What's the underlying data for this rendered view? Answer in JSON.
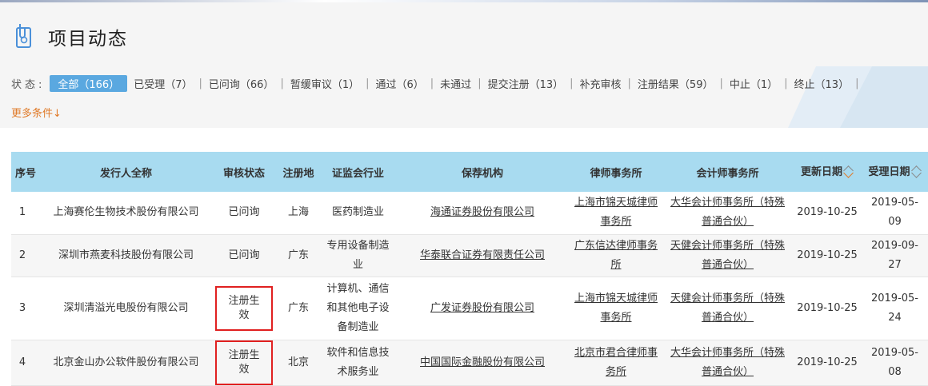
{
  "header": {
    "title": "项目动态"
  },
  "filter": {
    "status_label": "状态:",
    "items": [
      "全部（166）",
      "已受理（7）",
      "已问询（66）",
      "暂缓审议（1）",
      "通过（6）",
      "未通过",
      "提交注册（13）",
      "补充审核",
      "注册结果（59）",
      "中止（1）",
      "终止（13）"
    ],
    "active_index": 0,
    "more_label": "更多条件↓"
  },
  "table": {
    "headers": [
      "序号",
      "发行人全称",
      "审核状态",
      "注册地",
      "证监会行业",
      "保荐机构",
      "律师事务所",
      "会计师事务所",
      "更新日期",
      "受理日期"
    ],
    "rows": [
      {
        "idx": "1",
        "issuer": "上海赛伦生物技术股份有限公司",
        "status": "已问询",
        "region": "上海",
        "industry": "医药制造业",
        "sponsor": "海通证券股份有限公司",
        "law": "上海市锦天城律师事务所",
        "accounting": "大华会计师事务所（特殊普通合伙）",
        "updated": "2019-10-25",
        "accepted": "2019-05-09"
      },
      {
        "idx": "2",
        "issuer": "深圳市燕麦科技股份有限公司",
        "status": "已问询",
        "region": "广东",
        "industry": "专用设备制造业",
        "sponsor": "华泰联合证券有限责任公司",
        "law": "广东信达律师事务所",
        "accounting": "天健会计师事务所（特殊普通合伙）",
        "updated": "2019-10-25",
        "accepted": "2019-09-27"
      },
      {
        "idx": "3",
        "issuer": "深圳清溢光电股份有限公司",
        "status": "注册生效",
        "region": "广东",
        "industry": "计算机、通信和其他电子设备制造业",
        "sponsor": "广发证券股份有限公司",
        "law": "上海市锦天城律师事务所",
        "accounting": "天健会计师事务所（特殊普通合伙）",
        "updated": "2019-10-25",
        "accepted": "2019-05-24"
      },
      {
        "idx": "4",
        "issuer": "北京金山办公软件股份有限公司",
        "status": "注册生效",
        "region": "北京",
        "industry": "软件和信息技术服务业",
        "sponsor": "中国国际金融股份有限公司",
        "law": "北京市君合律师事务所",
        "accounting": "大华会计师事务所（特殊普通合伙）",
        "updated": "2019-10-25",
        "accepted": "2019-05-08"
      }
    ]
  },
  "colors": {
    "header_bg": "#a8dbf0",
    "active_filter": "#5aa8e0",
    "more_link": "#e07b2a",
    "highlight_box": "#e02020"
  }
}
